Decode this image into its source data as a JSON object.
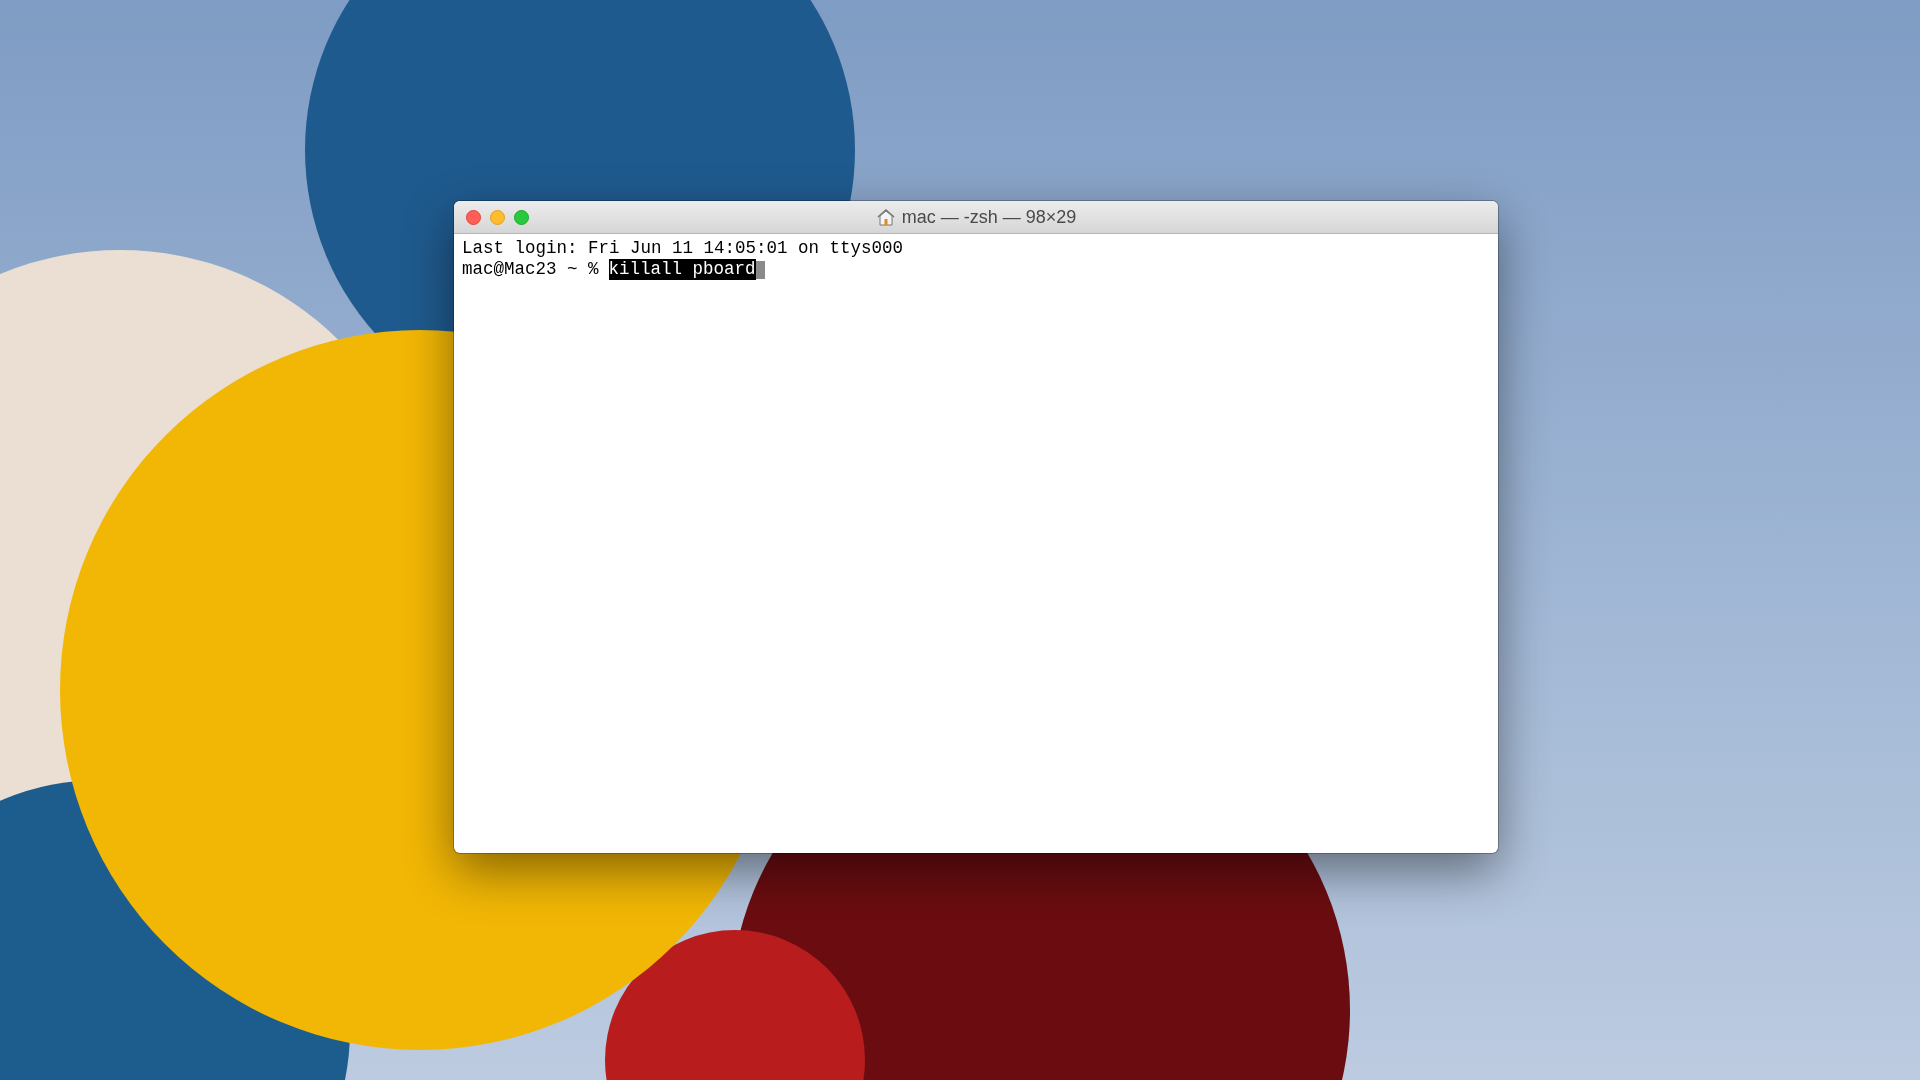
{
  "window": {
    "title": "mac — -zsh — 98×29"
  },
  "terminal": {
    "lines": [
      {
        "kind": "output",
        "text": "Last login: Fri Jun 11 14:05:01 on ttys000"
      },
      {
        "kind": "prompt",
        "prompt": "mac@Mac23 ~ %",
        "command": "killall pboard",
        "selected": true
      }
    ]
  }
}
